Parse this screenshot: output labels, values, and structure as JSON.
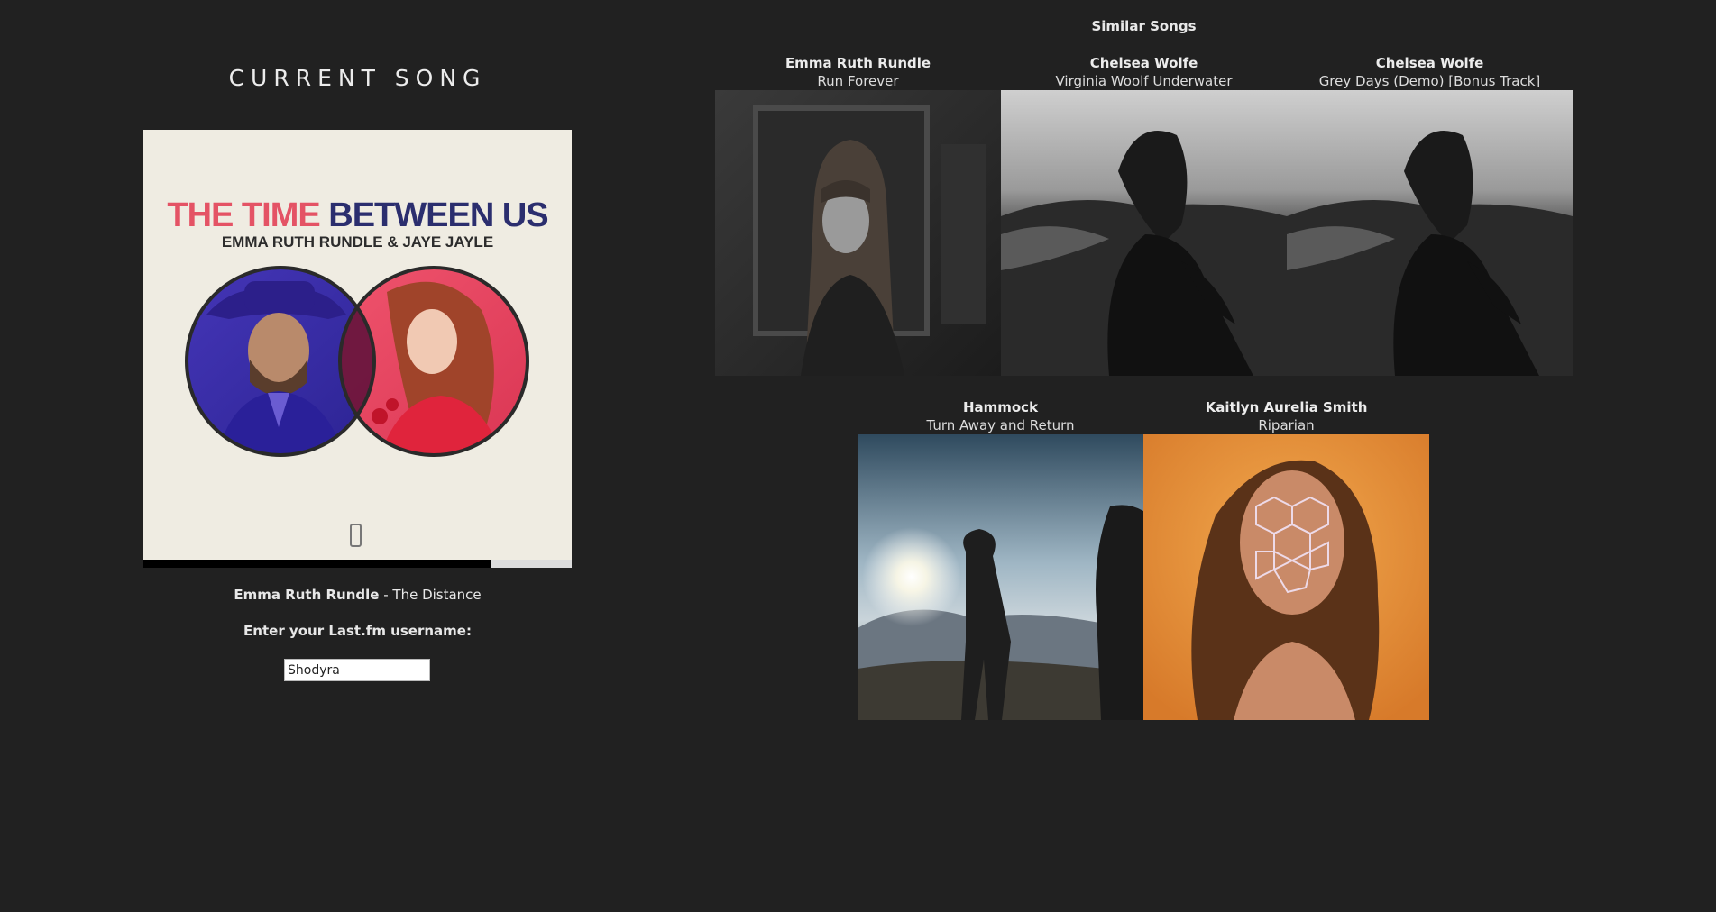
{
  "current": {
    "heading": "CURRENT SONG",
    "album_title_part1": "THE TIME",
    "album_title_part2": "BETWEEN US",
    "album_artists": "EMMA RUTH RUNDLE & JAYE JAYLE",
    "artist": "Emma Ruth Rundle",
    "separator": " - ",
    "track": "The Distance",
    "progress_fraction": 0.81
  },
  "login": {
    "label": "Enter your Last.fm username:",
    "value": "Shodyra"
  },
  "similar": {
    "heading": "Similar Songs",
    "songs": [
      {
        "artist": "Emma Ruth Rundle",
        "title": "Run Forever",
        "art": "grayscale portrait of woman with long hair"
      },
      {
        "artist": "Chelsea Wolfe",
        "title": "Virginia Woolf Underwater",
        "art": "grayscale figure with windswept hair on hillside"
      },
      {
        "artist": "Chelsea Wolfe",
        "title": "Grey Days (Demo) [Bonus Track]",
        "art": "grayscale figure with windswept hair on hillside"
      },
      {
        "artist": "Hammock",
        "title": "Turn Away and Return",
        "art": "two figures silhouetted against sun in mountains"
      },
      {
        "artist": "Kaitlyn Aurelia Smith",
        "title": "Riparian",
        "art": "woman with light pattern projected on face, orange background"
      }
    ]
  },
  "colors": {
    "background": "#212121",
    "title_red": "#e45365",
    "title_navy": "#2b2e6e"
  }
}
